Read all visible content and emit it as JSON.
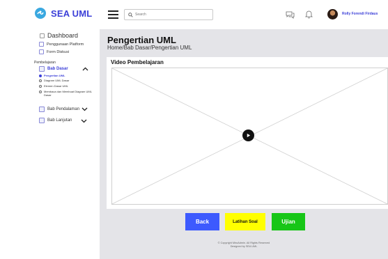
{
  "app": {
    "name": "SEA UML"
  },
  "header": {
    "search_placeholder": "Search",
    "user_name": "Rolly Forendi Firdaus"
  },
  "sidebar": {
    "dashboard": "Dashboard",
    "items": [
      {
        "label": "Penggunaan Platform",
        "icon": "people-icon"
      },
      {
        "label": "Form Diskusi",
        "icon": "chat-icon"
      }
    ],
    "section_label": "Pembelajaran",
    "babs": [
      {
        "label": "Bab Dasar",
        "expanded": true,
        "subs": [
          {
            "label": "Pengertian UML",
            "active": true
          },
          {
            "label": "Diagram UML Dasar",
            "active": false
          },
          {
            "label": "Elemen Dasar UML",
            "active": false
          },
          {
            "label": "Membaca dan Membuat Diagram UML Dasar",
            "active": false
          }
        ]
      },
      {
        "label": "Bab Pendalaman",
        "expanded": false
      },
      {
        "label": "Bab Lanjutan",
        "expanded": false
      }
    ]
  },
  "main": {
    "title": "Pengertian UML",
    "breadcrumb": "Home/Bab Dasar/Pengertian UML",
    "card_title": "Video Pembelajaran",
    "buttons": {
      "back": "Back",
      "latihan": "Latihan Soal",
      "ujian": "Ujian"
    },
    "footer_line1": "© Copyright MiroAdmin. All Rights Reserved",
    "footer_line2": "Designed by SEA UML"
  },
  "colors": {
    "accent": "#3b3fd8",
    "back_button": "#3d5afe",
    "latihan_button": "#ffff00",
    "ujian_button": "#17c617",
    "content_bg": "#e4e4e8"
  }
}
